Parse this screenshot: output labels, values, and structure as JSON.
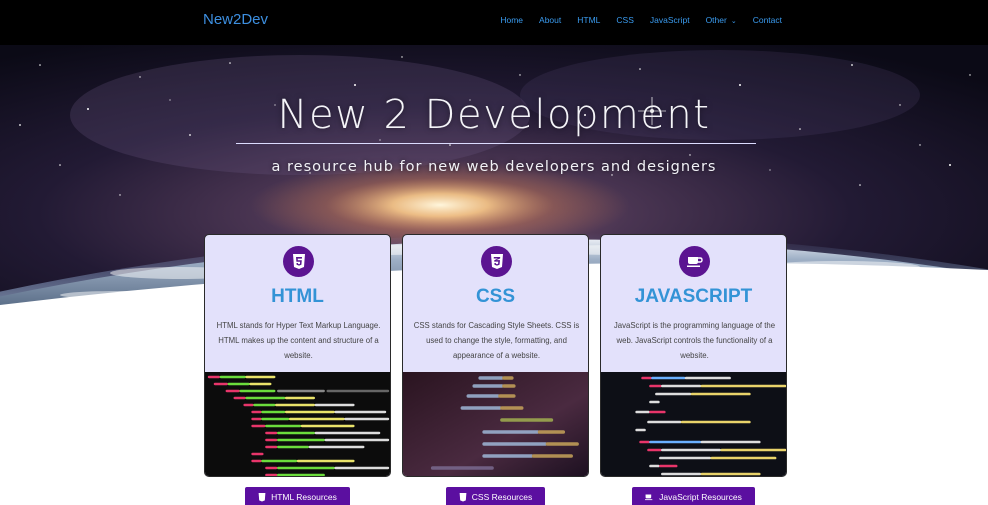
{
  "nav": {
    "brand": "New2Dev",
    "links": [
      "Home",
      "About",
      "HTML",
      "CSS",
      "JavaScript",
      "Other",
      "Contact"
    ]
  },
  "hero": {
    "title": "New 2 Development",
    "subtitle": "a resource hub for new web developers and designers"
  },
  "cards": [
    {
      "icon": "html5-icon",
      "title": "HTML",
      "text": "HTML stands for Hyper Text Markup Language. HTML makes up the content and structure of a website.",
      "button": "HTML Resources"
    },
    {
      "icon": "css3-icon",
      "title": "CSS",
      "text": "CSS stands for Cascading Style Sheets. CSS is used to change the style, formatting, and appearance of a website.",
      "button": "CSS Resources"
    },
    {
      "icon": "coffee-cup-icon",
      "title": "JAVASCRIPT",
      "text": "JavaScript is the programming language of the web. JavaScript controls the functionality of a website.",
      "button": "JavaScript Resources"
    }
  ],
  "colors": {
    "nav_bg": "#000000",
    "nav_link": "#3a9bef",
    "card_bg": "#e3e1fb",
    "card_title": "#3393d6",
    "icon_circle": "#5b1491",
    "button_bg": "#5b0fa0"
  }
}
